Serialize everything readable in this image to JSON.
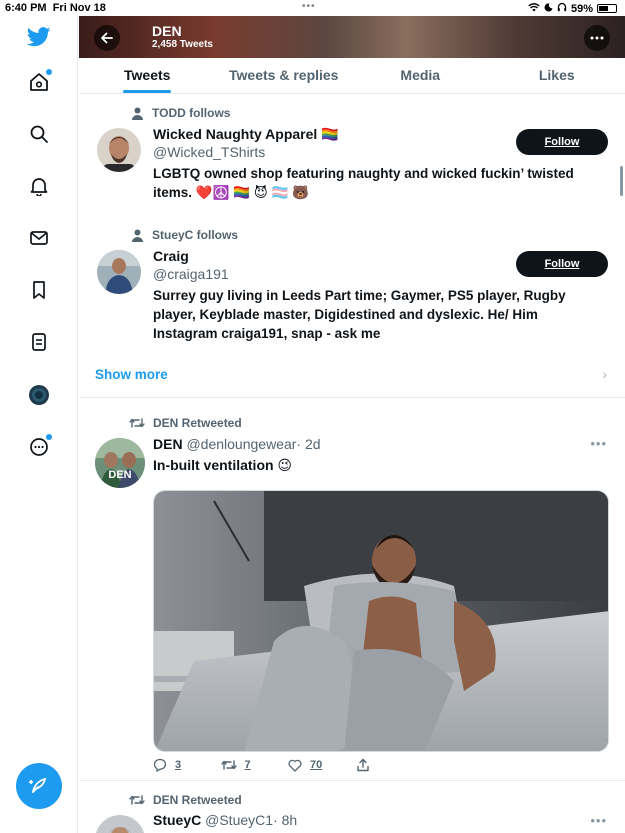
{
  "status_bar": {
    "time": "6:40 PM",
    "date": "Fri Nov 18",
    "battery": "59%",
    "battery_level": 0.59
  },
  "nav": {
    "items": [
      {
        "name": "twitter-logo-icon"
      },
      {
        "name": "home-icon",
        "badge": true
      },
      {
        "name": "search-icon"
      },
      {
        "name": "notifications-bell-icon"
      },
      {
        "name": "messages-envelope-icon"
      },
      {
        "name": "bookmarks-icon"
      },
      {
        "name": "lists-icon"
      },
      {
        "name": "profile-avatar-icon"
      },
      {
        "name": "more-options-icon",
        "badge": true
      }
    ],
    "compose_icon": "compose-tweet-icon"
  },
  "header": {
    "title": "DEN",
    "subtitle": "2,458 Tweets"
  },
  "tabs": [
    {
      "label": "Tweets",
      "active": true
    },
    {
      "label": "Tweets & replies",
      "active": false
    },
    {
      "label": "Media",
      "active": false
    },
    {
      "label": "Likes",
      "active": false
    }
  ],
  "suggestions": [
    {
      "follows": "TODD follows",
      "name": "Wicked Naughty Apparel 🏳️‍🌈",
      "handle": "@Wicked_TShirts",
      "bio": "LGBTQ owned shop featuring naughty and wicked fuckin’ twisted items. ❤️☮️ 🏳️‍🌈 😈 🏳️‍⚧️ 🐻",
      "button": "Follow"
    },
    {
      "follows": "StueyC follows",
      "name": "Craig",
      "handle": "@craiga191",
      "bio": "Surrey guy living in Leeds Part time; Gaymer, PS5 player, Rugby player, Keyblade master, Digidestined and dyslexic. He/ Him Instagram craiga191, snap - ask me",
      "button": "Follow"
    }
  ],
  "show_more": "Show more",
  "tweets": [
    {
      "retweeted_by": "DEN Retweeted",
      "name": "DEN",
      "handle": "@denloungewear",
      "time": "· 2d",
      "text": "In-built ventilation 😉",
      "avatar_text": "DEN",
      "replies": "3",
      "retweets": "7",
      "likes": "70"
    },
    {
      "retweeted_by": "DEN Retweeted",
      "name": "StueyC",
      "handle": "@StueyC1",
      "time": "· 8h"
    }
  ]
}
